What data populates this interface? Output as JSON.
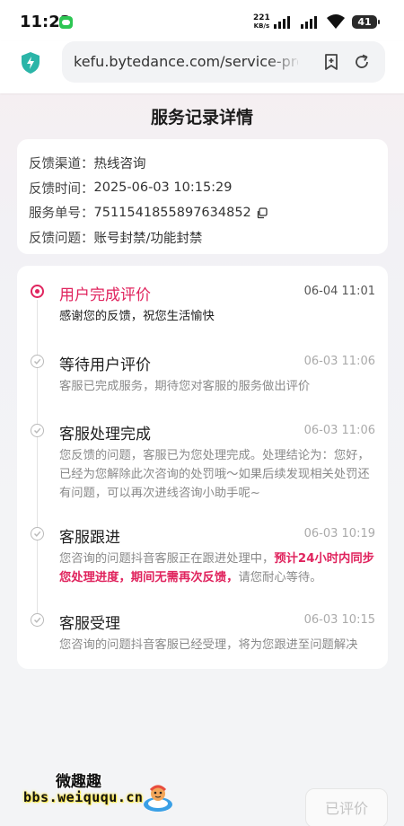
{
  "status_bar": {
    "time": "11:23",
    "net_speed_value": "221",
    "net_speed_unit": "KB/s",
    "battery": "41"
  },
  "browser": {
    "url": "kefu.bytedance.com/service-prog",
    "shield_color": "#2bb5a8"
  },
  "page": {
    "title": "服务记录详情"
  },
  "info": {
    "rows": [
      {
        "label": "反馈渠道：",
        "value": "热线咨询"
      },
      {
        "label": "反馈时间：",
        "value": "2025-06-03 10:15:29"
      },
      {
        "label": "服务单号：",
        "value": "7511541855897634852"
      },
      {
        "label": "反馈问题：",
        "value": "账号封禁/功能封禁"
      }
    ]
  },
  "timeline": {
    "accent_color": "#e0245e",
    "items": [
      {
        "title": "用户完成评价",
        "time": "06-04 11:01",
        "desc": "感谢您的反馈，祝您生活愉快",
        "active": true
      },
      {
        "title": "等待用户评价",
        "time": "06-03 11:06",
        "desc": "客服已完成服务，期待您对客服的服务做出评价",
        "active": false
      },
      {
        "title": "客服处理完成",
        "time": "06-03 11:06",
        "desc": "您反馈的问题，客服已为您处理完成。处理结论为：您好，已经为您解除此次咨询的处罚哦～如果后续发现相关处罚还有问题，可以再次进线咨询小助手呢~",
        "active": false
      },
      {
        "title": "客服跟进",
        "time": "06-03 10:19",
        "desc_before": "您咨询的问题抖音客服正在跟进处理中，",
        "desc_highlight": "预计24小时内同步您处理进度，期间无需再次反馈，",
        "desc_after": "请您耐心等待。",
        "active": false
      },
      {
        "title": "客服受理",
        "time": "06-03 10:15",
        "desc": "您咨询的问题抖音客服已经受理，将为您跟进至问题解决",
        "active": false
      }
    ]
  },
  "footer": {
    "watermark_title": "微趣趣",
    "watermark_url": "bbs.weiququ.cn",
    "rated_button": "已评价"
  }
}
